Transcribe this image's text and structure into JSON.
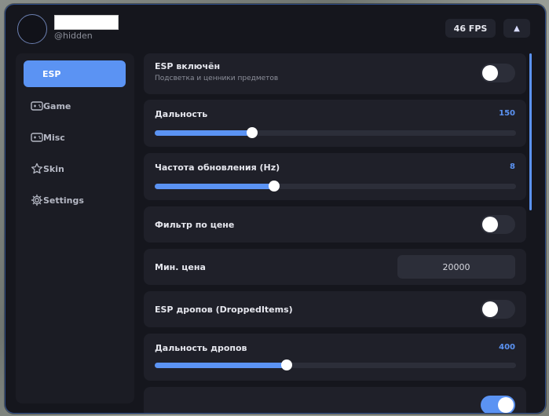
{
  "header": {
    "handle": "@hidden",
    "fps": "46 FPS",
    "collapse_icon": "▲"
  },
  "sidebar": {
    "items": [
      {
        "label": "ESP",
        "icon": "none",
        "active": true
      },
      {
        "label": "Game",
        "icon": "gamepad-icon",
        "active": false
      },
      {
        "label": "Misc",
        "icon": "gamepad-icon",
        "active": false
      },
      {
        "label": "Skin",
        "icon": "star-icon",
        "active": false
      },
      {
        "label": "Settings",
        "icon": "gear-icon",
        "active": false
      }
    ]
  },
  "settings": {
    "esp_enabled": {
      "title": "ESP включён",
      "subtitle": "Подсветка и ценники предметов",
      "on": false
    },
    "range": {
      "title": "Дальность",
      "value": "150",
      "fill": 0.27
    },
    "refresh_rate": {
      "title": "Частота обновления (Hz)",
      "value": "8",
      "fill": 0.33
    },
    "price_filter": {
      "title": "Фильтр по цене",
      "on": false
    },
    "min_price": {
      "title": "Мин. цена",
      "value": "20000"
    },
    "esp_drops": {
      "title": "ESP дропов (DroppedItems)",
      "on": false
    },
    "drop_range": {
      "title": "Дальность дропов",
      "value": "400",
      "fill": 0.366
    },
    "partial_toggle": {
      "on": true
    }
  },
  "colors": {
    "accent": "#5b93f3",
    "panel": "#15161d",
    "card": "#1f2029"
  }
}
